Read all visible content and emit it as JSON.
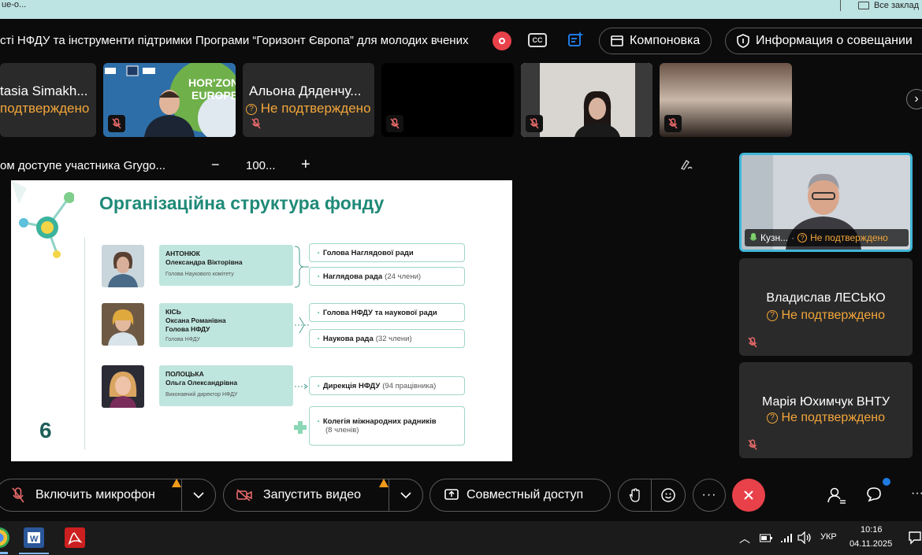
{
  "browser": {
    "left_text": "ue-o...",
    "bookmarks": "Все заклад"
  },
  "header": {
    "title": "сті НФДУ та інструменти підтримки Програми “Горизонт Європа” для молодих вчених",
    "cc_label": "CC",
    "layout_label": "Компоновка",
    "info_label": "Информация о совещании"
  },
  "participants_strip": [
    {
      "name": "tasia Simakh...",
      "status": "подтверждено"
    },
    {
      "name": "",
      "status": ""
    },
    {
      "name": "Альона Дяденчу...",
      "status": "Не подтверждено"
    },
    {
      "name": "",
      "status": ""
    },
    {
      "name": "",
      "status": ""
    },
    {
      "name": "",
      "status": ""
    }
  ],
  "share_bar": {
    "label": "ом доступе участника Grygo...",
    "zoom": "100...",
    "minus": "−",
    "plus": "+"
  },
  "slide": {
    "title": "Організаційна структура фонду",
    "page_number": "6",
    "people": [
      {
        "surname": "АНТОНЮК",
        "name": "Олександра Вікторівна",
        "role": "Голова Наукового комітету"
      },
      {
        "surname": "КІСЬ",
        "name": "Оксана Романівна",
        "name2": "Голова НФДУ",
        "role": "Голова НФДУ"
      },
      {
        "surname": "ПОЛОЦЬКА",
        "name": "Ольга Олександрівна",
        "role": "Виконавчий директор НФДУ"
      }
    ],
    "units": [
      {
        "bold": "Голова Наглядової ради",
        "dim": ""
      },
      {
        "bold": "Наглядова рада",
        "dim": "(24 члени)"
      },
      {
        "bold": "Голова НФДУ та наукової ради",
        "dim": ""
      },
      {
        "bold": "Наукова рада",
        "dim": "(32 члени)"
      },
      {
        "bold": "Дирекція НФДУ",
        "dim": "(94 працівника)"
      },
      {
        "bold": "Колегія міжнародних радників",
        "dim": "(8 членів)"
      }
    ]
  },
  "right_tiles": [
    {
      "name": "Кузн...",
      "status": "Не подтверждено"
    },
    {
      "name": "Владислав ЛЕСЬКО",
      "status": "Не подтверждено"
    },
    {
      "name": "Марія Юхимчук ВНТУ",
      "status": "Не подтверждено"
    }
  ],
  "controls": {
    "mic_label": "Включить микрофон",
    "video_label": "Запустить видео",
    "share_label": "Совместный доступ"
  },
  "taskbar": {
    "language": "УКР",
    "time": "10:16",
    "date": "04.11.2025"
  },
  "colors": {
    "status_orange": "#f3a63a",
    "end_call_red": "#e8414a",
    "slide_teal": "#1f8a78",
    "accent_blue": "#1f7ae0"
  }
}
